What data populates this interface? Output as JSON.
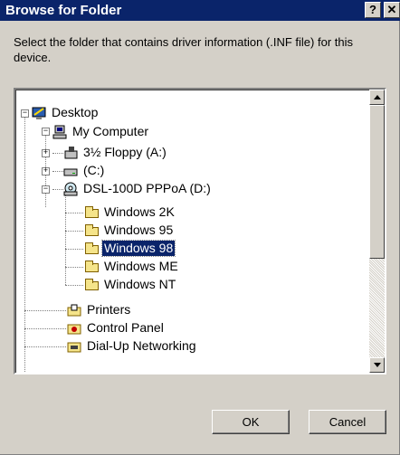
{
  "window": {
    "title": "Browse for Folder",
    "help_label": "?",
    "close_label": "✕"
  },
  "description": "Select the folder that contains driver information (.INF file) for this device.",
  "tree": {
    "items": [
      {
        "label": "Desktop",
        "icon": "desktop-icon"
      },
      {
        "label": "My Computer",
        "icon": "computer-icon"
      },
      {
        "label": "3½ Floppy (A:)",
        "icon": "floppy-drive-icon"
      },
      {
        "label": "(C:)",
        "icon": "hard-drive-icon"
      },
      {
        "label": "DSL-100D PPPoA (D:)",
        "icon": "cd-drive-icon"
      },
      {
        "label": "Windows 2K",
        "icon": "folder-icon"
      },
      {
        "label": "Windows 95",
        "icon": "folder-icon"
      },
      {
        "label": "Windows 98",
        "icon": "folder-icon",
        "selected": true
      },
      {
        "label": "Windows ME",
        "icon": "folder-icon"
      },
      {
        "label": "Windows NT",
        "icon": "folder-icon"
      },
      {
        "label": "Printers",
        "icon": "printers-folder-icon"
      },
      {
        "label": "Control Panel",
        "icon": "control-panel-icon"
      },
      {
        "label": "Dial-Up Networking",
        "icon": "dialup-networking-icon"
      }
    ]
  },
  "buttons": {
    "ok": "OK",
    "cancel": "Cancel"
  },
  "colors": {
    "title_bar": "#0a246a",
    "dialog_face": "#d4d0c8",
    "selection": "#0a246a"
  }
}
